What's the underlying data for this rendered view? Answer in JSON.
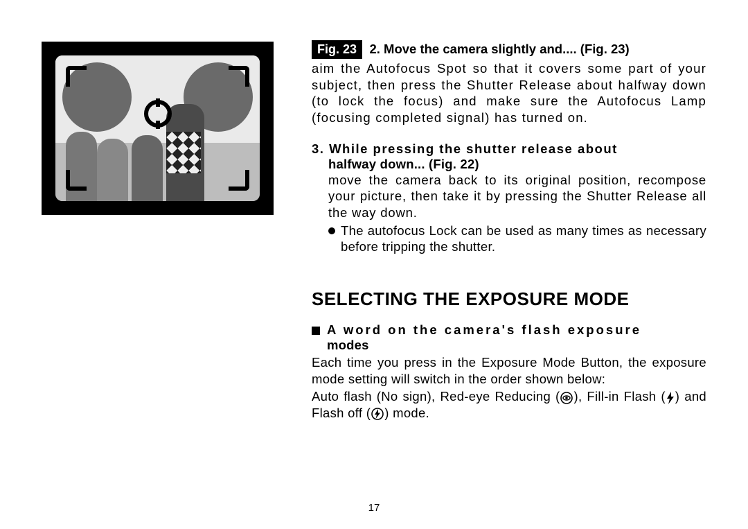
{
  "figure": {
    "label": "Fig. 23"
  },
  "step2": {
    "title": "2. Move the camera slightly and.... (Fig. 23)",
    "body": "aim the Autofocus Spot so that it covers some part of your subject, then press the Shutter Release about halfway down (to lock the focus) and make sure the Autofocus Lamp (focusing completed signal) has turned on."
  },
  "step3": {
    "title_line1": "3. While pressing the shutter release about",
    "title_line2": "halfway down... (Fig. 22)",
    "body": "move the camera back to its original position, recompose your picture, then take it by pressing the Shutter Release all the way down.",
    "bullet": "The autofocus Lock can be used as many times as necessary before tripping the shutter."
  },
  "section": {
    "heading": "SELECTING THE EXPOSURE MODE",
    "sub_line1": "A word on the camera's flash exposure",
    "sub_line2": "modes",
    "para1": "Each time you press in the Exposure Mode Button, the exposure mode setting will switch in the order shown below:",
    "modes_pre": "Auto flash (No sign), Red-eye Reducing (",
    "modes_mid1": "), Fill-in Flash (",
    "modes_mid2": ") and Flash off (",
    "modes_end": ") mode."
  },
  "page_number": "17",
  "icons": {
    "red_eye": "red-eye-icon",
    "fill_in_flash": "flash-icon",
    "flash_off": "flash-off-icon"
  }
}
